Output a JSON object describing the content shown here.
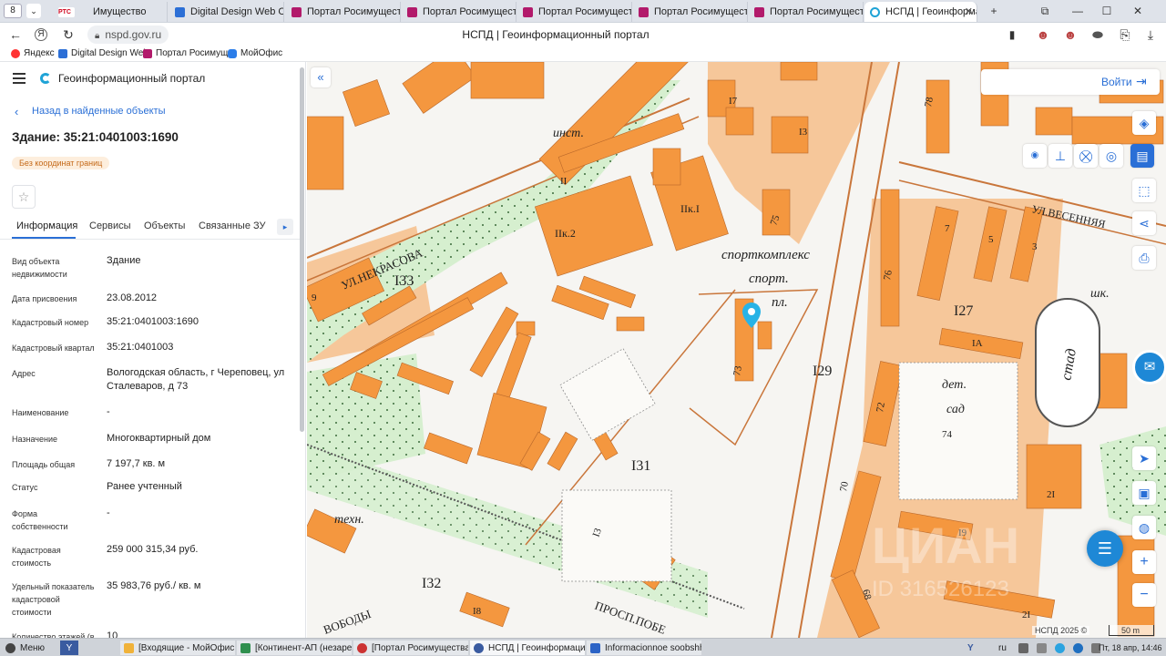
{
  "browser": {
    "tab_counter": "8",
    "tabs": [
      {
        "label": "Имущество",
        "icon": "rts-tender-icon"
      },
      {
        "label": "Digital Design Web Client",
        "icon": "digital-design-icon"
      },
      {
        "label": "Портал Росимущества",
        "icon": "rosimushchestvo-icon"
      },
      {
        "label": "Портал Росимущества",
        "icon": "rosimushchestvo-icon"
      },
      {
        "label": "Портал Росимущества",
        "icon": "rosimushchestvo-icon"
      },
      {
        "label": "Портал Росимущества",
        "icon": "rosimushchestvo-icon"
      },
      {
        "label": "Портал Росимущества",
        "icon": "rosimushchestvo-icon"
      },
      {
        "label": "НСПД | Геоинформационный портал",
        "icon": "nspd-icon",
        "active": true
      }
    ],
    "new_tab": "+",
    "address": "nspd.gov.ru",
    "page_title": "НСПД | Геоинформационный портал",
    "bookmarks": [
      {
        "label": "Яндекс"
      },
      {
        "label": "Digital Design Web"
      },
      {
        "label": "Портал Росимущ"
      },
      {
        "label": "МойОфис"
      }
    ]
  },
  "app": {
    "title": "Геоинформационный портал",
    "back_link": "Назад в найденные объекты",
    "object_title": "Здание: 35:21:0401003:1690",
    "badge": "Без координат границ",
    "tabs": [
      "Информация",
      "Сервисы",
      "Объекты",
      "Связанные ЗУ"
    ],
    "fields": [
      {
        "label": "Вид объекта недвижимости",
        "value": "Здание"
      },
      {
        "label": "Дата присвоения",
        "value": "23.08.2012"
      },
      {
        "label": "Кадастровый номер",
        "value": "35:21:0401003:1690"
      },
      {
        "label": "Кадастровый квартал",
        "value": "35:21:0401003"
      },
      {
        "label": "Адрес",
        "value": "Вологодская область, г Череповец, ул Сталеваров, д 73"
      },
      {
        "label": "Наименование",
        "value": "-"
      },
      {
        "label": "Назначение",
        "value": "Многоквартирный дом"
      },
      {
        "label": "Площадь общая",
        "value": "7 197,7 кв. м"
      },
      {
        "label": "Статус",
        "value": "Ранее учтенный"
      },
      {
        "label": "Форма собственности",
        "value": "-"
      },
      {
        "label": "Кадастровая стоимость",
        "value": "259 000 315,34 руб."
      },
      {
        "label": "Удельный показатель кадастровой стоимости",
        "value": "35 983,76 руб./ кв. м"
      },
      {
        "label": "Количество этажей (в",
        "value": "10"
      }
    ]
  },
  "map": {
    "login": "Войти",
    "labels": {
      "street_nekrasova": "УЛ.НЕКРАСОВА",
      "street_vesennyaya": "УЛ.ВЕСЕННЯЯ",
      "prosp_pobedy": "ПРОСП.ПОБЕ",
      "svobody": "ВОБОДЫ",
      "inst": "инст.",
      "sportkompleks": "спорткомплекс",
      "sport": "спорт.",
      "pl": "пл.",
      "tekhn": "техн.",
      "det": "дет.",
      "sad": "сад",
      "shk": "шк.",
      "stad": "стад",
      "q133": "I33",
      "q131": "I31",
      "q132": "I32",
      "q129": "I29",
      "q127": "I27",
      "h17": "I7",
      "h13": "I3",
      "h75": "75",
      "h78": "78",
      "h11": "II",
      "h11k2": "IIк.2",
      "h11k1": "IIк.I",
      "h73": "73",
      "h9": "9",
      "h13b": "I3",
      "h18": "I8",
      "h76": "76",
      "h7": "7",
      "h5": "5",
      "h3": "3",
      "h1a": "IA",
      "h72": "72",
      "h74": "74",
      "h70": "70",
      "h19": "I9",
      "h68": "68",
      "h21": "2I",
      "h21b": "2I",
      "watermark": "ЦИАН",
      "watermark_id": "ID 316526123"
    },
    "copyright": "НСПД 2025 ©",
    "scale": "50 m"
  },
  "taskbar": {
    "menu": "Меню",
    "items": [
      "[Входящие - МойОфис П...",
      "[Континент-АП (незарег...",
      "[Портал Росимущества - ...",
      "НСПД | Геоинформацио...",
      "Informacionnoe soobshhe..."
    ],
    "lang": "ru",
    "clock": "Пт, 18 апр, 14:46"
  }
}
